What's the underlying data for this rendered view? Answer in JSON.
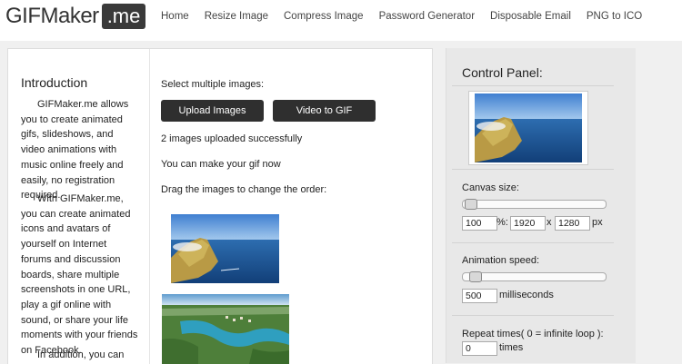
{
  "logo": {
    "text": "GIFMaker",
    "badge": ".me"
  },
  "nav": [
    "Home",
    "Resize Image",
    "Compress Image",
    "Password Generator",
    "Disposable Email",
    "PNG to ICO"
  ],
  "intro": {
    "title": "Introduction",
    "p1": "GIFMaker.me allows you to create animated gifs, slideshows, and video animations with music online freely and easily, no registration required.",
    "p2": "With GIFMaker.me, you can create animated icons and avatars of yourself on Internet forums and discussion boards, share multiple screenshots in one URL, play a gif online with sound, or share your life moments with your friends on Facebook.",
    "p3": "In addition, you can"
  },
  "upload": {
    "select_label": "Select multiple images:",
    "upload_button": "Upload Images",
    "video_button": "Video to GIF",
    "status": "2 images uploaded successfully",
    "ready": "You can make your gif now",
    "drag_hint": "Drag the images to change the order:"
  },
  "control_panel": {
    "title": "Control Panel:",
    "canvas_size_label": "Canvas size:",
    "canvas_percent": "100",
    "percent_symbol": "%:",
    "canvas_width": "1920",
    "times_symbol": "x",
    "canvas_height": "1280",
    "px_unit": "px",
    "animation_speed_label": "Animation speed:",
    "speed_value": "500",
    "speed_unit": "milliseconds",
    "repeat_label": "Repeat times( 0 = infinite loop ):",
    "repeat_value": "0",
    "repeat_unit": "times"
  },
  "colors": {
    "button_bg": "#2f2f2f",
    "panel_bg": "#e8e8e8",
    "page_bg": "#f0f0f0"
  }
}
